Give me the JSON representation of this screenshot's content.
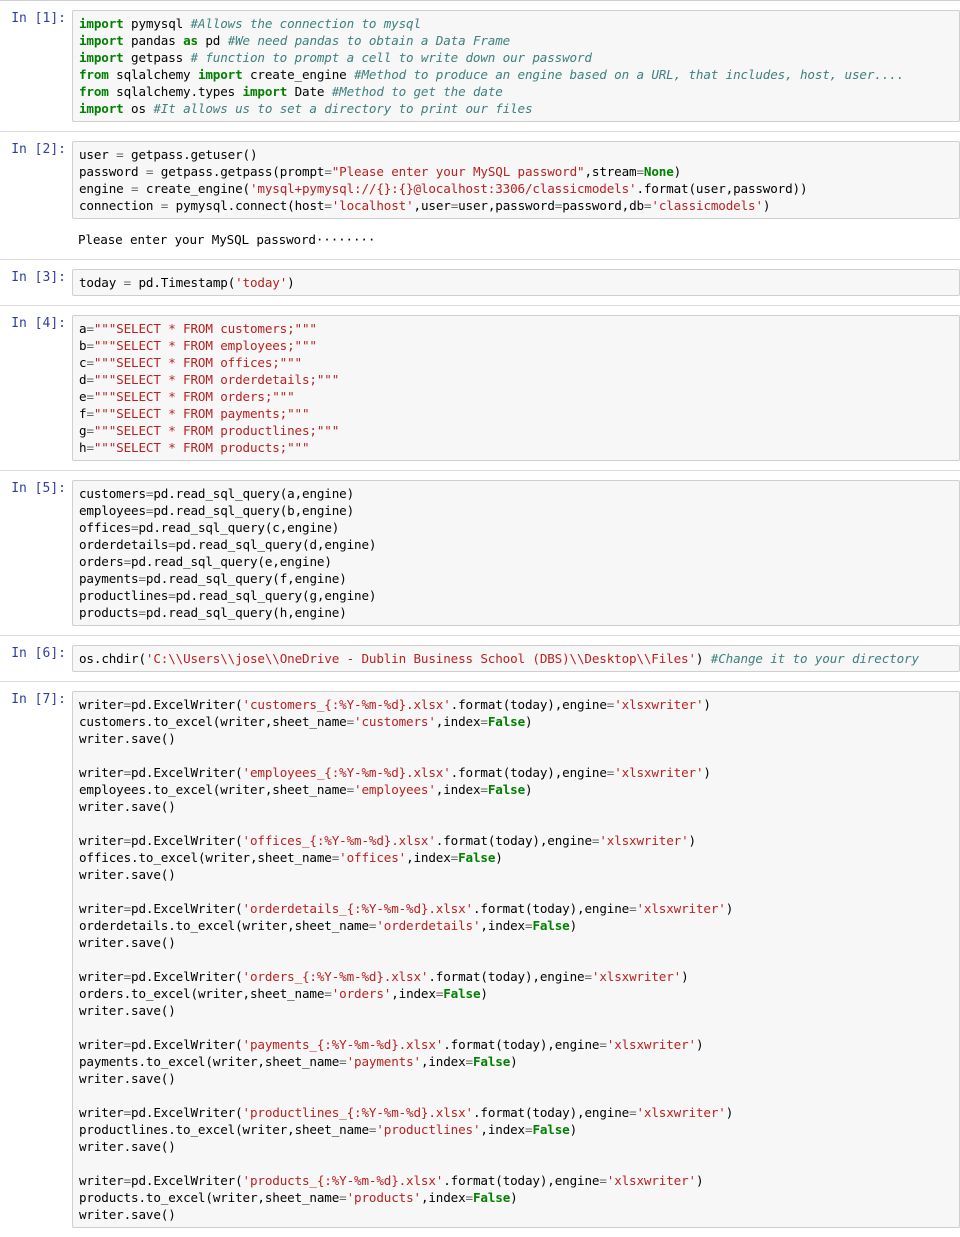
{
  "notebook": {
    "kind": "jupyter-notebook",
    "background": "#ffffff",
    "cell_background": "#f7f7f7",
    "cell_border": "#cfcfcf",
    "prompt_color": "#303f9f",
    "token_colors": {
      "keyword": "#008000",
      "constant": "#008000",
      "comment": "#408080",
      "string": "#ba2121",
      "operator": "#666666",
      "text": "#000000"
    }
  },
  "cells": [
    {
      "prompt": "In [1]:",
      "execution_count": 1,
      "type": "code",
      "source": "import pymysql #Allows the connection to mysql\nimport pandas as pd #We need pandas to obtain a Data Frame\nimport getpass # function to prompt a cell to write down our password\nfrom sqlalchemy import create_engine #Method to produce an engine based on a URL, that includes, host, user....\nfrom sqlalchemy.types import Date #Method to get the date\nimport os #It allows us to set a directory to print our files",
      "output": null
    },
    {
      "prompt": "In [2]:",
      "execution_count": 2,
      "type": "code",
      "source": "user = getpass.getuser()\npassword = getpass.getpass(prompt=\"Please enter your MySQL password\",stream=None)\nengine = create_engine('mysql+pymysql://{}:{}@localhost:3306/classicmodels'.format(user,password))\nconnection = pymysql.connect(host='localhost',user=user,password=password,db='classicmodels')",
      "output": "Please enter your MySQL password········"
    },
    {
      "prompt": "In [3]:",
      "execution_count": 3,
      "type": "code",
      "source": "today = pd.Timestamp('today')",
      "output": null
    },
    {
      "prompt": "In [4]:",
      "execution_count": 4,
      "type": "code",
      "source": "a=\"\"\"SELECT * FROM customers;\"\"\"\nb=\"\"\"SELECT * FROM employees;\"\"\"\nc=\"\"\"SELECT * FROM offices;\"\"\"\nd=\"\"\"SELECT * FROM orderdetails;\"\"\"\ne=\"\"\"SELECT * FROM orders;\"\"\"\nf=\"\"\"SELECT * FROM payments;\"\"\"\ng=\"\"\"SELECT * FROM productlines;\"\"\"\nh=\"\"\"SELECT * FROM products;\"\"\"",
      "output": null
    },
    {
      "prompt": "In [5]:",
      "execution_count": 5,
      "type": "code",
      "source": "customers=pd.read_sql_query(a,engine)\nemployees=pd.read_sql_query(b,engine)\noffices=pd.read_sql_query(c,engine)\norderdetails=pd.read_sql_query(d,engine)\norders=pd.read_sql_query(e,engine)\npayments=pd.read_sql_query(f,engine)\nproductlines=pd.read_sql_query(g,engine)\nproducts=pd.read_sql_query(h,engine)",
      "output": null
    },
    {
      "prompt": "In [6]:",
      "execution_count": 6,
      "type": "code",
      "source": "os.chdir('C:\\\\Users\\\\jose\\\\OneDrive - Dublin Business School (DBS)\\\\Desktop\\\\Files') #Change it to your directory",
      "output": null
    },
    {
      "prompt": "In [7]:",
      "execution_count": 7,
      "type": "code",
      "source": "writer=pd.ExcelWriter('customers_{:%Y-%m-%d}.xlsx'.format(today),engine='xlsxwriter')\ncustomers.to_excel(writer,sheet_name='customers',index=False)\nwriter.save()\n\nwriter=pd.ExcelWriter('employees_{:%Y-%m-%d}.xlsx'.format(today),engine='xlsxwriter')\nemployees.to_excel(writer,sheet_name='employees',index=False)\nwriter.save()\n\nwriter=pd.ExcelWriter('offices_{:%Y-%m-%d}.xlsx'.format(today),engine='xlsxwriter')\noffices.to_excel(writer,sheet_name='offices',index=False)\nwriter.save()\n\nwriter=pd.ExcelWriter('orderdetails_{:%Y-%m-%d}.xlsx'.format(today),engine='xlsxwriter')\norderdetails.to_excel(writer,sheet_name='orderdetails',index=False)\nwriter.save()\n\nwriter=pd.ExcelWriter('orders_{:%Y-%m-%d}.xlsx'.format(today),engine='xlsxwriter')\norders.to_excel(writer,sheet_name='orders',index=False)\nwriter.save()\n\nwriter=pd.ExcelWriter('payments_{:%Y-%m-%d}.xlsx'.format(today),engine='xlsxwriter')\npayments.to_excel(writer,sheet_name='payments',index=False)\nwriter.save()\n\nwriter=pd.ExcelWriter('productlines_{:%Y-%m-%d}.xlsx'.format(today),engine='xlsxwriter')\nproductlines.to_excel(writer,sheet_name='productlines',index=False)\nwriter.save()\n\nwriter=pd.ExcelWriter('products_{:%Y-%m-%d}.xlsx'.format(today),engine='xlsxwriter')\nproducts.to_excel(writer,sheet_name='products',index=False)\nwriter.save()",
      "output": null
    }
  ]
}
